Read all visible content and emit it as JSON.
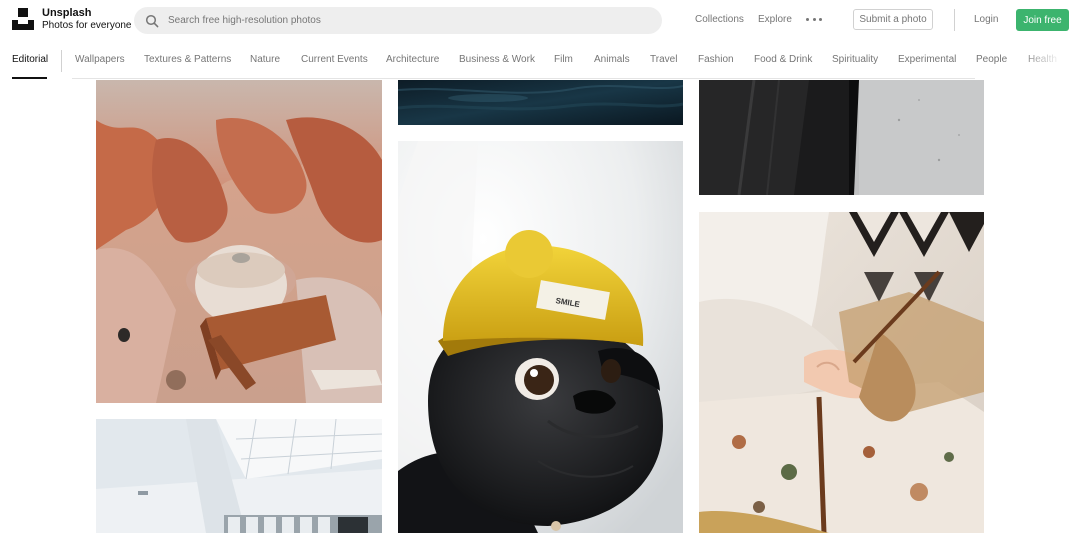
{
  "header": {
    "brand_name": "Unsplash",
    "brand_tagline": "Photos for everyone",
    "logo_icon": "unsplash-logo-icon",
    "search_icon": "search-icon",
    "search_placeholder": "Search free high-resolution photos",
    "search_value": "",
    "nav_collections": "Collections",
    "nav_explore": "Explore",
    "more_icon": "ellipsis-icon",
    "submit_label": "Submit a photo",
    "login_label": "Login",
    "join_label": "Join free",
    "join_color": "#3cb46e"
  },
  "topics": {
    "active": "Editorial",
    "items": [
      "Editorial",
      "Wallpapers",
      "Textures & Patterns",
      "Nature",
      "Current Events",
      "Architecture",
      "Business & Work",
      "Film",
      "Animals",
      "Travel",
      "Fashion",
      "Food & Drink",
      "Spirituality",
      "Experimental",
      "People",
      "Health"
    ]
  },
  "photos": {
    "column_1": [
      "desert-canyon-yurt",
      "white-interior-skylight"
    ],
    "column_2": [
      "dark-night-water",
      "pug-yellow-beanie"
    ],
    "column_3": [
      "dark-road-asphalt",
      "child-gift-box"
    ]
  }
}
